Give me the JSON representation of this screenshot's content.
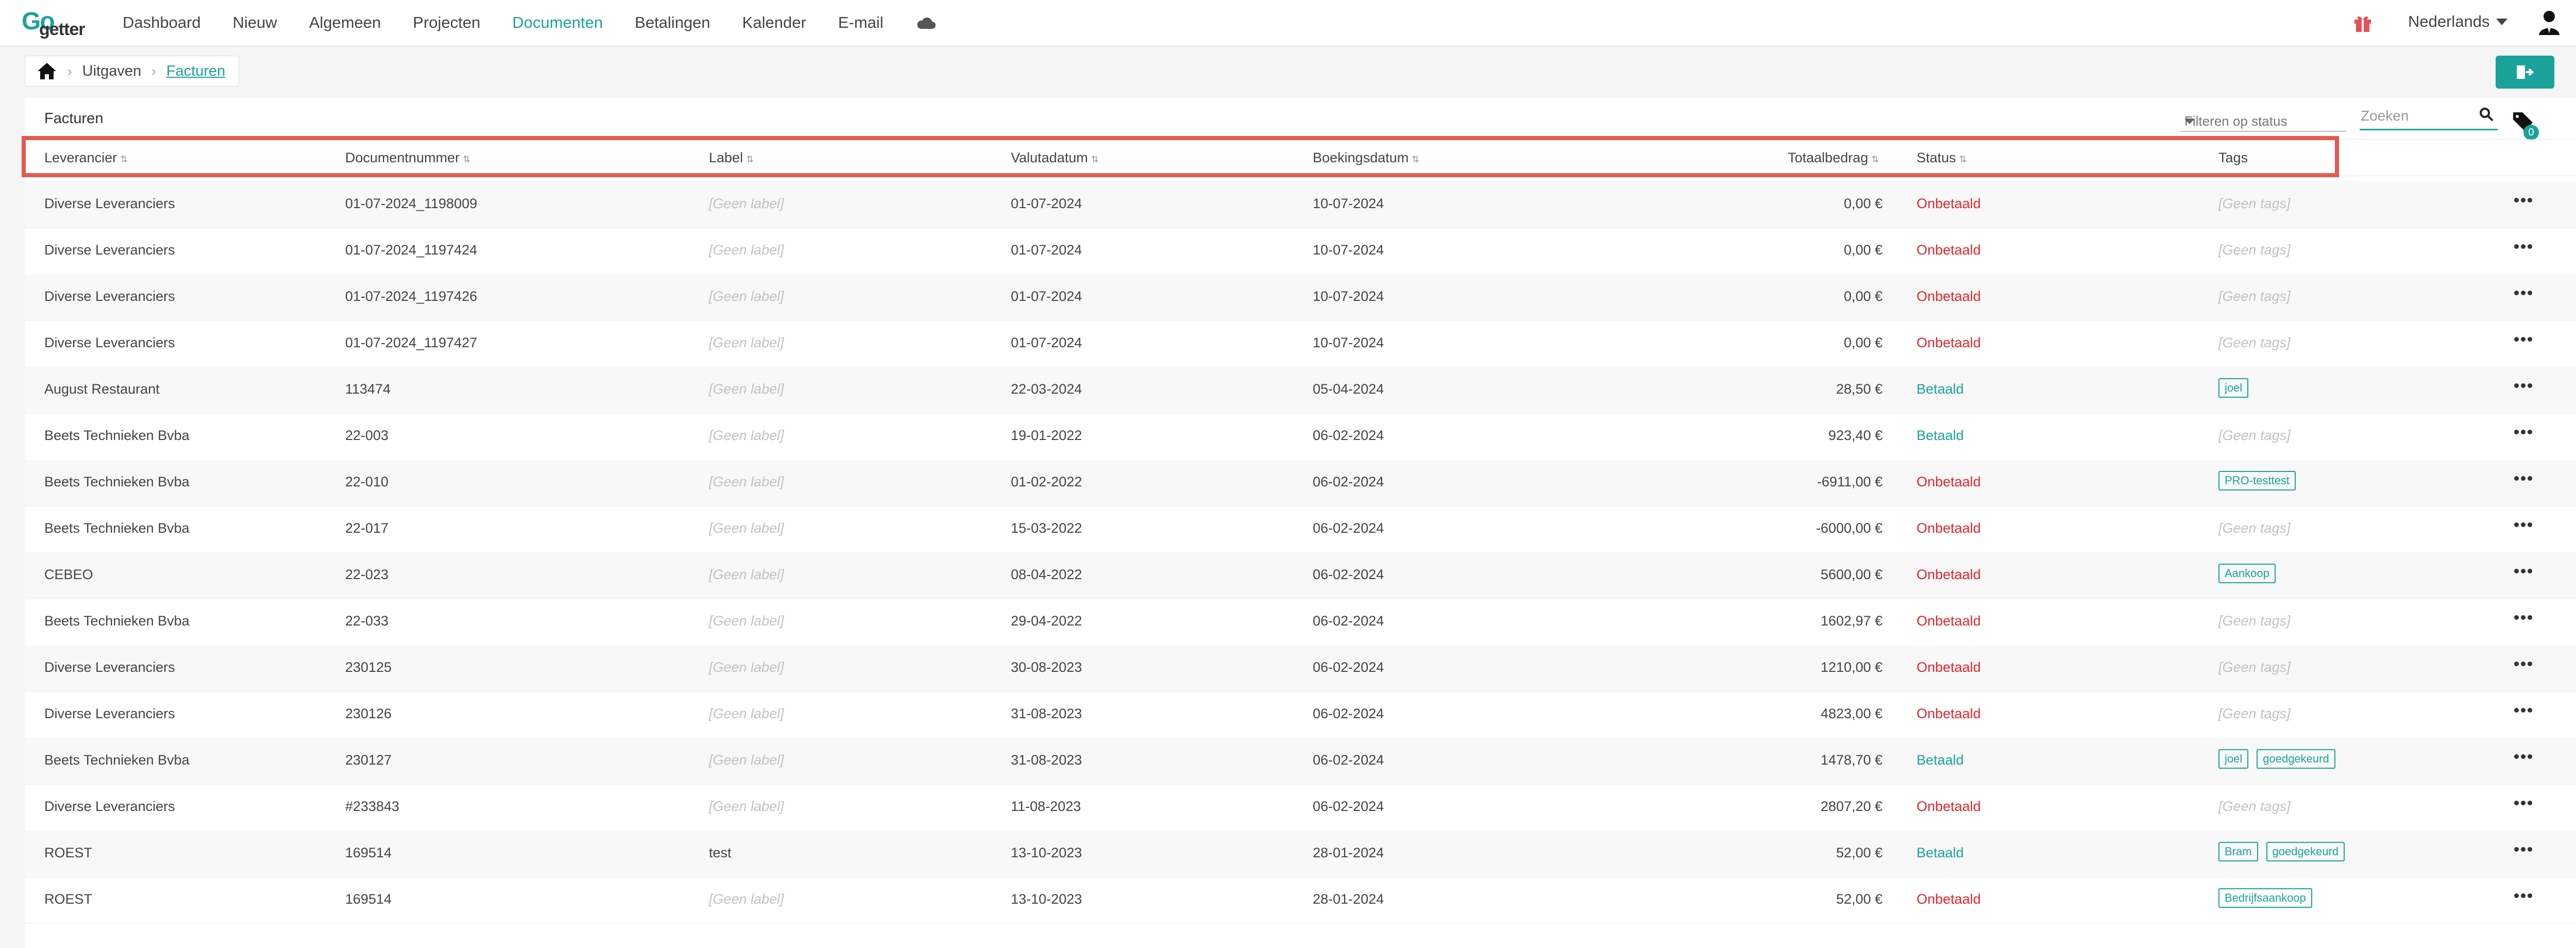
{
  "brand": {
    "logo_go": "Go",
    "logo_getter": "getter"
  },
  "nav": {
    "items": [
      "Dashboard",
      "Nieuw",
      "Algemeen",
      "Projecten",
      "Documenten",
      "Betalingen",
      "Kalender",
      "E-mail"
    ],
    "active": "Documenten",
    "language": "Nederlands",
    "accent_color": "#1aa39a"
  },
  "breadcrumb": {
    "items": [
      "Uitgaven",
      "Facturen"
    ]
  },
  "panel": {
    "title": "Facturen",
    "status_filter_placeholder": "Filteren op status",
    "search_placeholder": "Zoeken",
    "tag_filter_count": "0"
  },
  "table": {
    "columns": [
      "Leverancier",
      "Documentnummer",
      "Label",
      "Valutadatum",
      "Boekingsdatum",
      "Totaalbedrag",
      "Status",
      "Tags"
    ],
    "rows": [
      {
        "supplier": "Diverse Leveranciers",
        "doc": "01-07-2024_1198009",
        "label": "[Geen label]",
        "value_date": "01-07-2024",
        "booking_date": "10-07-2024",
        "amount": "0,00 €",
        "status": "Onbetaald",
        "tags": []
      },
      {
        "supplier": "Diverse Leveranciers",
        "doc": "01-07-2024_1197424",
        "label": "[Geen label]",
        "value_date": "01-07-2024",
        "booking_date": "10-07-2024",
        "amount": "0,00 €",
        "status": "Onbetaald",
        "tags": []
      },
      {
        "supplier": "Diverse Leveranciers",
        "doc": "01-07-2024_1197426",
        "label": "[Geen label]",
        "value_date": "01-07-2024",
        "booking_date": "10-07-2024",
        "amount": "0,00 €",
        "status": "Onbetaald",
        "tags": []
      },
      {
        "supplier": "Diverse Leveranciers",
        "doc": "01-07-2024_1197427",
        "label": "[Geen label]",
        "value_date": "01-07-2024",
        "booking_date": "10-07-2024",
        "amount": "0,00 €",
        "status": "Onbetaald",
        "tags": []
      },
      {
        "supplier": "August Restaurant",
        "doc": "113474",
        "label": "[Geen label]",
        "value_date": "22-03-2024",
        "booking_date": "05-04-2024",
        "amount": "28,50 €",
        "status": "Betaald",
        "tags": [
          "joel"
        ]
      },
      {
        "supplier": "Beets Technieken Bvba",
        "doc": "22-003",
        "label": "[Geen label]",
        "value_date": "19-01-2022",
        "booking_date": "06-02-2024",
        "amount": "923,40 €",
        "status": "Betaald",
        "tags": []
      },
      {
        "supplier": "Beets Technieken Bvba",
        "doc": "22-010",
        "label": "[Geen label]",
        "value_date": "01-02-2022",
        "booking_date": "06-02-2024",
        "amount": "-6911,00 €",
        "status": "Onbetaald",
        "tags": [
          "PRO-testtest"
        ]
      },
      {
        "supplier": "Beets Technieken Bvba",
        "doc": "22-017",
        "label": "[Geen label]",
        "value_date": "15-03-2022",
        "booking_date": "06-02-2024",
        "amount": "-6000,00 €",
        "status": "Onbetaald",
        "tags": []
      },
      {
        "supplier": "CEBEO",
        "doc": "22-023",
        "label": "[Geen label]",
        "value_date": "08-04-2022",
        "booking_date": "06-02-2024",
        "amount": "5600,00 €",
        "status": "Onbetaald",
        "tags": [
          "Aankoop"
        ]
      },
      {
        "supplier": "Beets Technieken Bvba",
        "doc": "22-033",
        "label": "[Geen label]",
        "value_date": "29-04-2022",
        "booking_date": "06-02-2024",
        "amount": "1602,97 €",
        "status": "Onbetaald",
        "tags": []
      },
      {
        "supplier": "Diverse Leveranciers",
        "doc": "230125",
        "label": "[Geen label]",
        "value_date": "30-08-2023",
        "booking_date": "06-02-2024",
        "amount": "1210,00 €",
        "status": "Onbetaald",
        "tags": []
      },
      {
        "supplier": "Diverse Leveranciers",
        "doc": "230126",
        "label": "[Geen label]",
        "value_date": "31-08-2023",
        "booking_date": "06-02-2024",
        "amount": "4823,00 €",
        "status": "Onbetaald",
        "tags": []
      },
      {
        "supplier": "Beets Technieken Bvba",
        "doc": "230127",
        "label": "[Geen label]",
        "value_date": "31-08-2023",
        "booking_date": "06-02-2024",
        "amount": "1478,70 €",
        "status": "Betaald",
        "tags": [
          "joel",
          "goedgekeurd"
        ]
      },
      {
        "supplier": "Diverse Leveranciers",
        "doc": "#233843",
        "label": "[Geen label]",
        "value_date": "11-08-2023",
        "booking_date": "06-02-2024",
        "amount": "2807,20 €",
        "status": "Onbetaald",
        "tags": []
      },
      {
        "supplier": "ROEST",
        "doc": "169514",
        "label": "test",
        "value_date": "13-10-2023",
        "booking_date": "28-01-2024",
        "amount": "52,00 €",
        "status": "Betaald",
        "tags": [
          "Bram",
          "goedgekeurd"
        ]
      },
      {
        "supplier": "ROEST",
        "doc": "169514",
        "label": "[Geen label]",
        "value_date": "13-10-2023",
        "booking_date": "28-01-2024",
        "amount": "52,00 €",
        "status": "Onbetaald",
        "tags": [
          "Bedrijfsaankoop"
        ]
      }
    ],
    "empty_tags_text": "[Geen tags]"
  }
}
